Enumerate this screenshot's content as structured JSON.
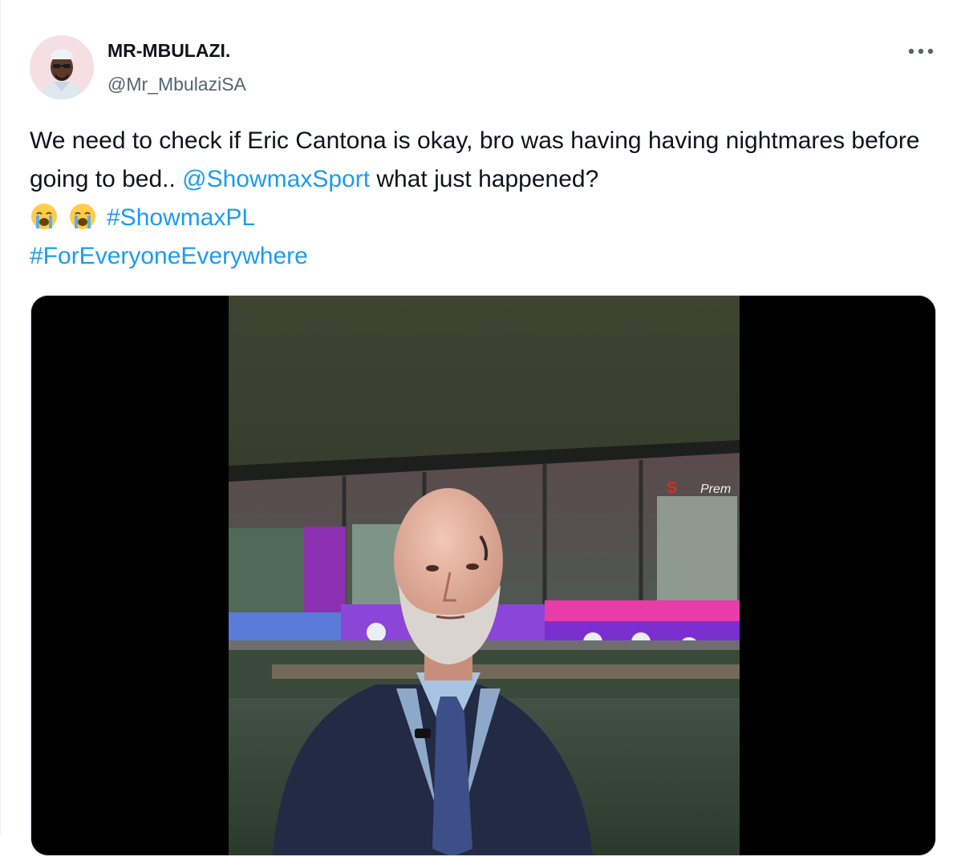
{
  "tweet": {
    "author": {
      "display_name": "MR-MBULAZI.",
      "handle": "@Mr_MbulaziSA",
      "avatar_icon": "profile-photo"
    },
    "more_icon": "more-horizontal-icon",
    "text": {
      "part1": "We need to check if Eric Cantona is okay, bro was having having nightmares before going to bed.. ",
      "mention": "@ShowmaxSport",
      "part2": " what just happened?",
      "emoji": "😭",
      "hashtag1": "#ShowmaxPL",
      "hashtag2": "#ForEveryoneEverywhere"
    },
    "media": {
      "type": "video-still",
      "overlay_text": "Prem",
      "broadcaster_logo_icon": "supersport-s-logo"
    }
  },
  "colors": {
    "link": "#1d9bf0",
    "text": "#0f1419",
    "secondary": "#536471"
  }
}
